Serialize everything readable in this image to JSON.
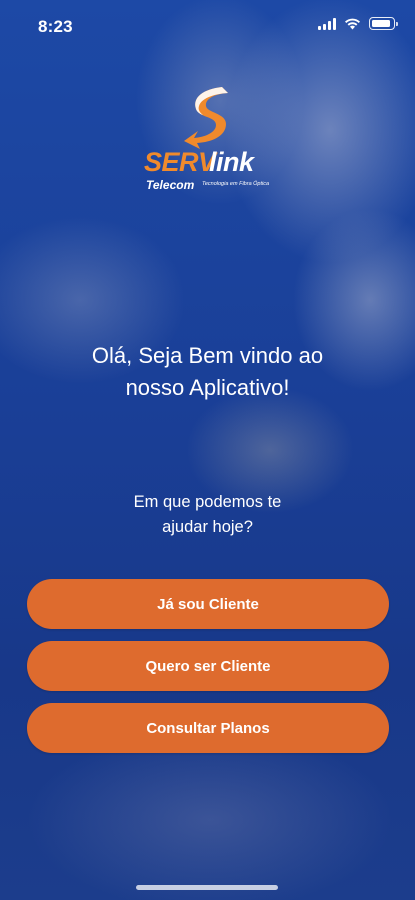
{
  "status_bar": {
    "time": "8:23",
    "icons": [
      "signal-icon",
      "wifi-icon",
      "battery-icon"
    ]
  },
  "logo": {
    "brand_part1": "SERV",
    "brand_part2": "link",
    "sub_brand": "Telecom",
    "tagline": "Tecnologia em Fibra Óptica",
    "icon": "s-arrow-logo-icon",
    "colors": {
      "orange": "#f08a2c",
      "white": "#ffffff"
    }
  },
  "welcome": {
    "line1": "Olá, Seja Bem vindo ao",
    "line2": "nosso Aplicativo!"
  },
  "question": {
    "line1": "Em que podemos te",
    "line2": "ajudar hoje?"
  },
  "actions": {
    "existing_client": "Já sou Cliente",
    "become_client": "Quero ser Cliente",
    "check_plans": "Consultar Planos"
  },
  "colors": {
    "background": "#1b3f93",
    "button": "#de6b2e",
    "text": "#ffffff"
  }
}
